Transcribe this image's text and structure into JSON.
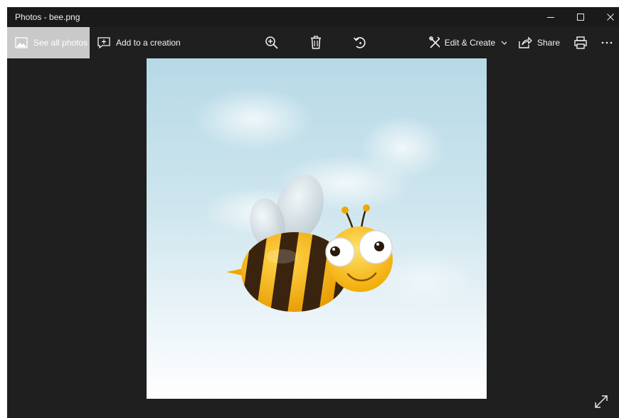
{
  "window": {
    "title": "Photos - bee.png",
    "controls": [
      "minimize-icon",
      "maximize-icon",
      "close-icon"
    ]
  },
  "toolbar": {
    "see_all_photos": "See all photos",
    "add_to_creation": "Add to a creation",
    "edit_create": "Edit & Create",
    "share": "Share",
    "icons": [
      "zoom-in-icon",
      "delete-icon",
      "rotate-icon",
      "print-icon",
      "more-icon"
    ]
  },
  "colors": {
    "chrome": "#1f1f1f",
    "titlebar": "#1a1a1a",
    "active_button": "#c9c9c9",
    "text": "#f2f2f2"
  }
}
